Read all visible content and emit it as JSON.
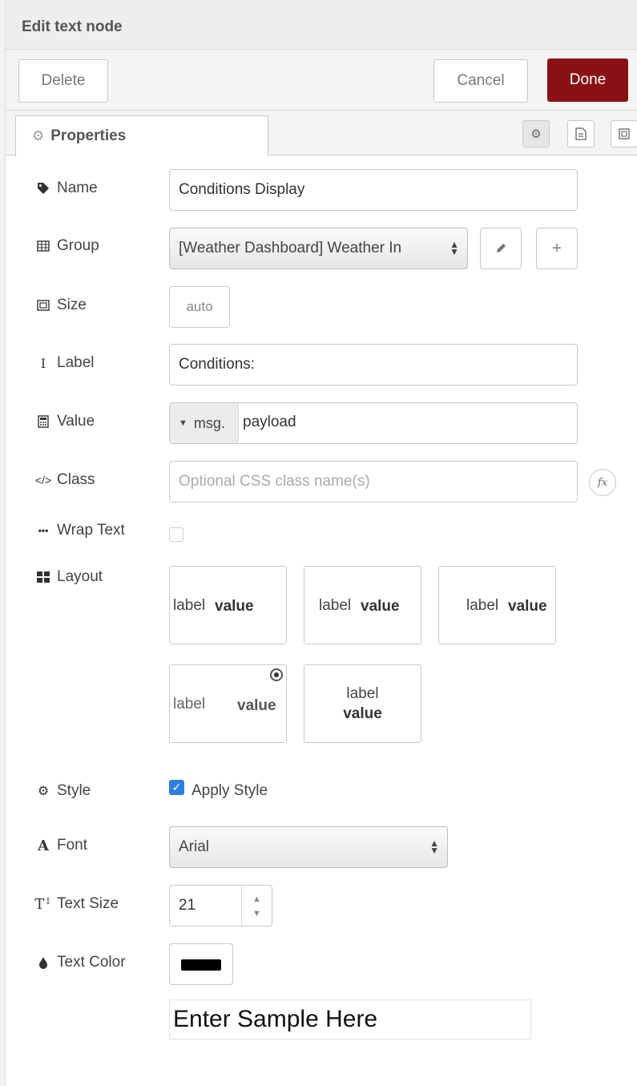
{
  "header": {
    "title": "Edit text node"
  },
  "toolbar": {
    "delete_label": "Delete",
    "cancel_label": "Cancel",
    "done_label": "Done"
  },
  "tabs": {
    "properties_label": "Properties"
  },
  "fields": {
    "name": {
      "label": "Name",
      "value": "Conditions Display"
    },
    "group": {
      "label": "Group",
      "value": "[Weather Dashboard] Weather In"
    },
    "size": {
      "label": "Size",
      "value": "auto"
    },
    "label": {
      "label": "Label",
      "value": "Conditions:"
    },
    "value": {
      "label": "Value",
      "prefix": "msg.",
      "value": "payload"
    },
    "class": {
      "label": "Class",
      "placeholder": "Optional CSS class name(s)",
      "fx": "fx"
    },
    "wrap_text": {
      "label": "Wrap Text",
      "checked": false
    },
    "layout": {
      "label": "Layout",
      "options": [
        {
          "label": "label",
          "value": "value"
        },
        {
          "label": "label",
          "value": "value"
        },
        {
          "label": "label",
          "value": "value"
        },
        {
          "label": "label",
          "value": "value",
          "selected": true
        },
        {
          "label": "label",
          "value": "value"
        }
      ]
    },
    "style": {
      "label": "Style",
      "checkbox_label": "Apply Style",
      "checked": true
    },
    "font": {
      "label": "Font",
      "value": "Arial"
    },
    "text_size": {
      "label": "Text Size",
      "value": "21"
    },
    "text_color": {
      "label": "Text Color",
      "color": "#000000"
    },
    "sample": {
      "value": "Enter Sample Here"
    }
  },
  "colors": {
    "done_button": "#8b1014",
    "checkbox_accent": "#2f7de1"
  }
}
